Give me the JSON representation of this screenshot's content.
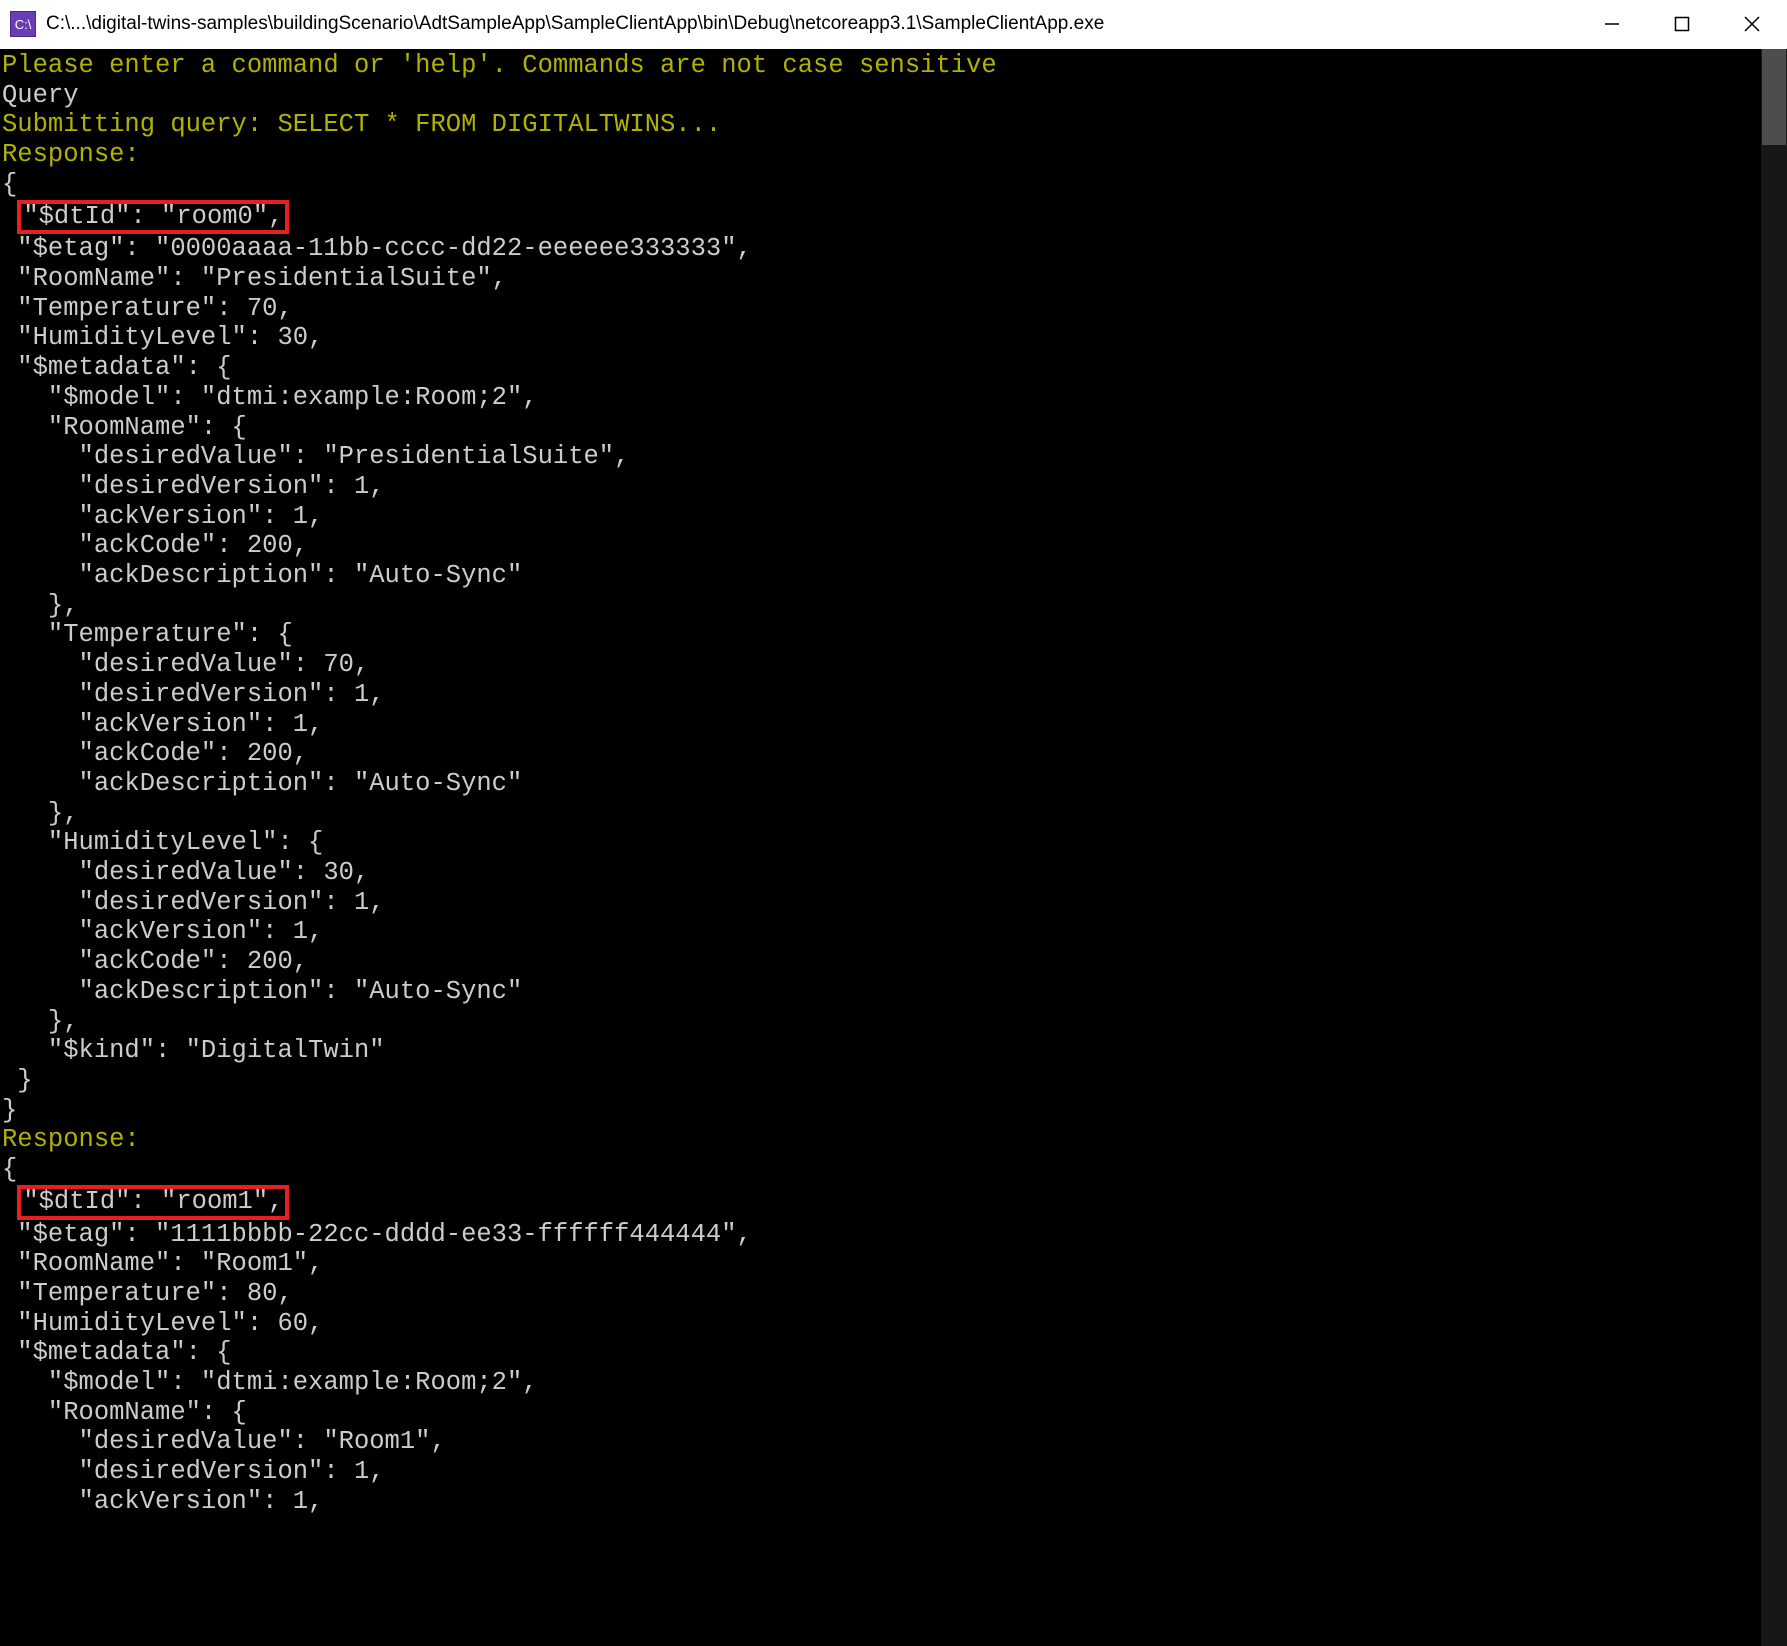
{
  "window": {
    "title": "C:\\...\\digital-twins-samples\\buildingScenario\\AdtSampleApp\\SampleClientApp\\bin\\Debug\\netcoreapp3.1\\SampleClientApp.exe",
    "icon_label": "C:\\"
  },
  "terminal": {
    "prompt_help": "Please enter a command or 'help'. Commands are not case sensitive",
    "command": "Query",
    "submit_line": "Submitting query: SELECT * FROM DIGITALTWINS...",
    "response_label": "Response:",
    "open_brace": "{",
    "close_brace_open_indent": " }",
    "close_brace": "}",
    "responses": [
      {
        "dtid_line": "\"$dtId\": \"room0\",",
        "lines": [
          " \"$etag\": \"0000aaaa-11bb-cccc-dd22-eeeeee333333\",",
          " \"RoomName\": \"PresidentialSuite\",",
          " \"Temperature\": 70,",
          " \"HumidityLevel\": 30,",
          " \"$metadata\": {",
          "   \"$model\": \"dtmi:example:Room;2\",",
          "   \"RoomName\": {",
          "     \"desiredValue\": \"PresidentialSuite\",",
          "     \"desiredVersion\": 1,",
          "     \"ackVersion\": 1,",
          "     \"ackCode\": 200,",
          "     \"ackDescription\": \"Auto-Sync\"",
          "   },",
          "   \"Temperature\": {",
          "     \"desiredValue\": 70,",
          "     \"desiredVersion\": 1,",
          "     \"ackVersion\": 1,",
          "     \"ackCode\": 200,",
          "     \"ackDescription\": \"Auto-Sync\"",
          "   },",
          "   \"HumidityLevel\": {",
          "     \"desiredValue\": 30,",
          "     \"desiredVersion\": 1,",
          "     \"ackVersion\": 1,",
          "     \"ackCode\": 200,",
          "     \"ackDescription\": \"Auto-Sync\"",
          "   },",
          "   \"$kind\": \"DigitalTwin\"",
          " }",
          "}"
        ]
      },
      {
        "dtid_line": "\"$dtId\": \"room1\",",
        "lines": [
          " \"$etag\": \"1111bbbb-22cc-dddd-ee33-ffffff444444\",",
          " \"RoomName\": \"Room1\",",
          " \"Temperature\": 80,",
          " \"HumidityLevel\": 60,",
          " \"$metadata\": {",
          "   \"$model\": \"dtmi:example:Room;2\",",
          "   \"RoomName\": {",
          "     \"desiredValue\": \"Room1\",",
          "     \"desiredVersion\": 1,",
          "     \"ackVersion\": 1,"
        ]
      }
    ]
  }
}
